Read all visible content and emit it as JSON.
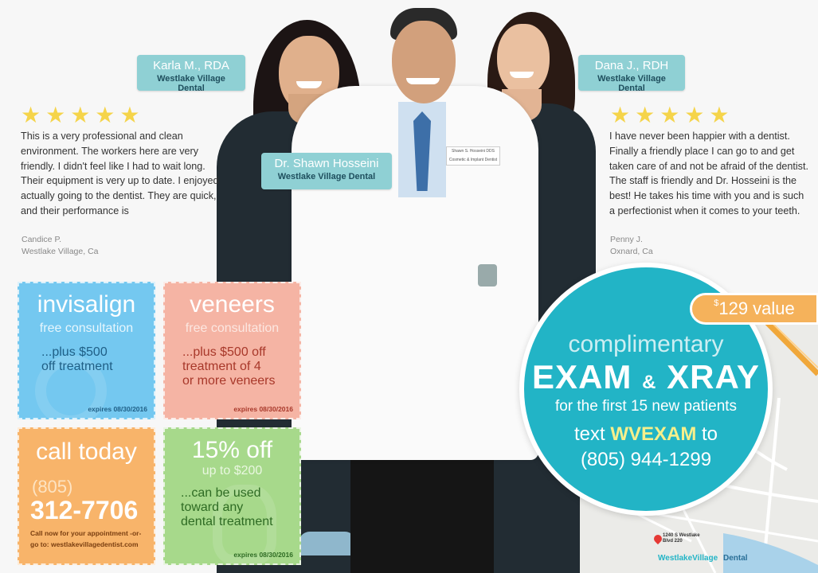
{
  "staff": [
    {
      "name": "Karla M., RDA",
      "practice": "Westlake Village Dental"
    },
    {
      "name": "Dr. Shawn Hosseini",
      "practice": "Westlake Village Dental"
    },
    {
      "name": "Dana J., RDH",
      "practice": "Westlake Village Dental"
    }
  ],
  "reviews": [
    {
      "stars": "★★★★★",
      "text": "This is a very professional and clean environment. The workers here are very friendly. I didn't feel like I had to wait long. Their equipment is very up to date. I enjoyed actually going to the dentist. They are quick, and their performance is",
      "author": "Candice P.",
      "location": "Westlake Village, Ca"
    },
    {
      "stars": "★★★★★",
      "text": "I have never been happier with a dentist. Finally a friendly place I can go to and get taken care of and not be afraid of the dentist. The staff is friendly and Dr. Hosseini is the best! He takes his time with you and is such a perfectionist when it comes to your teeth.",
      "author": "Penny J.",
      "location": "Oxnard, Ca"
    }
  ],
  "coupons": {
    "invisalign": {
      "title": "invisalign",
      "subtitle": "free consultation",
      "line1": "...plus $500",
      "line2": "off treatment",
      "expires": "expires 08/30/2016"
    },
    "veneers": {
      "title": "veneers",
      "subtitle": "free consultation",
      "line1": "...plus $500 off",
      "line2": "treatment of 4",
      "line3": "or more veneers",
      "expires": "expires 08/30/2016"
    },
    "call": {
      "title": "call today",
      "area": "(805)",
      "number": "312-7706",
      "note1": "Call now for your appointment -or-",
      "note2": "go to: westlakevillagedentist.com"
    },
    "discount": {
      "title": "15% off",
      "subtitle": "up to $200",
      "line1": "...can be used",
      "line2": "toward any",
      "line3": "dental treatment",
      "expires": "expires 08/30/2016"
    }
  },
  "offer": {
    "value_currency": "$",
    "value_text": "129 value",
    "line1": "complimentary",
    "exam": "EXAM",
    "amp": "&",
    "xray": "XRAY",
    "line3": "for the first 15 new patients",
    "text_prefix": "text",
    "code": "WVEXAM",
    "text_suffix": "to",
    "phone": "(805) 944-1299"
  },
  "map": {
    "pin_address": "1240 S Westlake Blvd 220",
    "brand1": "WestlakeVillage",
    "brand2": "Dental"
  },
  "colors": {
    "teal": "#22b4c6",
    "invisalign": "#74c8f0",
    "veneers": "#f5b4a4",
    "call": "#f8b46a",
    "discount": "#a7d98b",
    "star": "#f5d44a",
    "nametag": "#8fd0d4"
  }
}
